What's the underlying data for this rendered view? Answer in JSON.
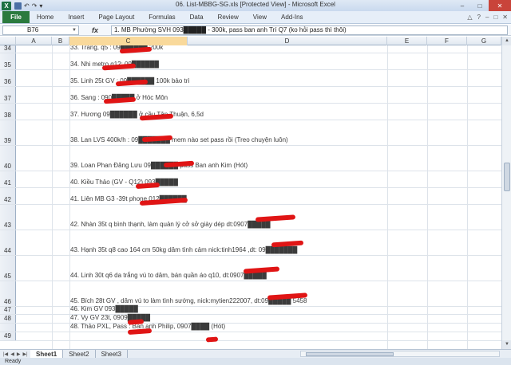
{
  "window": {
    "title": "06. List-MBBG-SG.xls  [Protected View] - Microsoft Excel",
    "logo_letter": "X",
    "controls": {
      "minimize": "–",
      "maximize": "□",
      "close": "✕"
    }
  },
  "ribbon": {
    "file_label": "File",
    "tabs": [
      "Home",
      "Insert",
      "Page Layout",
      "Formulas",
      "Data",
      "Review",
      "View",
      "Add-Ins"
    ],
    "right_icons": [
      "△",
      "?",
      "–",
      "□",
      "✕"
    ]
  },
  "formula_bar": {
    "name_box": "B76",
    "fx_label": "fx",
    "content": "1. MB Phường SVH 093█████ - 300k, pass ban anh Trí Q7 (ko hỏi pass thì thôi)"
  },
  "columns": [
    "A",
    "B",
    "C",
    "D",
    "E",
    "F",
    "G"
  ],
  "selected_column": "C",
  "rows": [
    {
      "num": "34",
      "h": 10,
      "text": "33. Trang, q5 : 09██████ 200k"
    },
    {
      "num": "35",
      "h": 21,
      "text": "34. Nhi metro q12: 09██████"
    },
    {
      "num": "36",
      "h": 21,
      "text": "35. Linh 25t GV : 09██████ 100k bảo trì"
    },
    {
      "num": "37",
      "h": 21,
      "text": "36. Sang : 090█████ ở Hóc Môn"
    },
    {
      "num": "38",
      "h": 21,
      "text": "37. Hương 09██████ ở cầu Tân Thuận, 6,5d"
    },
    {
      "num": "39",
      "h": 32,
      "text": "38. Lan  LVS 400k/h : 09███████ mem nào set pass rồi  (Treo chuyện luôn)"
    },
    {
      "num": "40",
      "h": 32,
      "text": "39. Loan Phan Đăng Lưu 09██████ pass Ban anh Kim (Hót)"
    },
    {
      "num": "41",
      "h": 21,
      "text": "40. Kiều Thảo (GV - Q12) 093█████"
    },
    {
      "num": "42",
      "h": 21,
      "text": "41. Liên MB G3 -39t phone 012██████"
    },
    {
      "num": "43",
      "h": 32,
      "text": "42. Nhàn 35t q bình thạnh, làm quản lý cở sở giày dép dt:0907█████"
    },
    {
      "num": "44",
      "h": 32,
      "text": "43. Hạnh 35t q8 cao 164 cm 50kg dâm tình cảm nick:tinh1964 ,dt: 09███████"
    },
    {
      "num": "45",
      "h": 32,
      "text": "44. Linh 30t q6 da trắng vú to dâm, bán quần áo q10, dt:0907█████"
    },
    {
      "num": "46",
      "h": 32,
      "text": "45. Bích 28t GV , dâm vú to làm tình sướng, nick:mytien222007, dt:09█████ 5458"
    },
    {
      "num": "47",
      "h": 10,
      "text": "46. Kim GV 093█████"
    },
    {
      "num": "48",
      "h": 11,
      "text": "47. Vy GV 23t, 0909█████"
    },
    {
      "num": "",
      "h": 11,
      "text": "48. Thảo PXL, Pass : Ban anh Philip, 0907████ (Hót)"
    },
    {
      "num": "49",
      "h": 11,
      "text": ""
    }
  ],
  "sheets": [
    "Sheet1",
    "Sheet2",
    "Sheet3"
  ],
  "active_sheet": "Sheet1",
  "status": "Ready"
}
